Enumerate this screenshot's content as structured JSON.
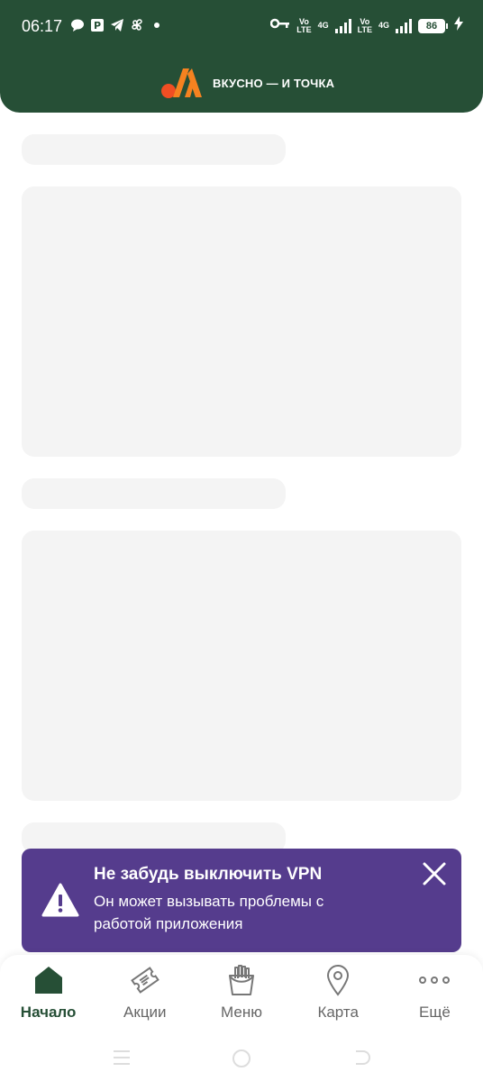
{
  "status_bar": {
    "time": "06:17",
    "volte_1": "Vo\nLTE",
    "net_1": "4G",
    "volte_2": "Vo\nLTE",
    "net_2": "4G",
    "battery": "86",
    "icons_left": [
      "chat-bubble-icon",
      "parking-icon",
      "telegram-icon",
      "fan-icon",
      "dot-icon"
    ],
    "icons_right": [
      "vpn-key-icon",
      "signal-icon",
      "signal-icon",
      "battery-icon",
      "charging-icon"
    ]
  },
  "header": {
    "brand": "ВКУСНО — И ТОЧКА",
    "brand_colors": {
      "dot": "#f04e23",
      "bars": "#f58220"
    },
    "background": "#264f36"
  },
  "toast": {
    "title": "Не забудь выключить VPN",
    "message": "Он может вызывать проблемы с работой приложения",
    "background": "#553c8d",
    "icons": [
      "warning-icon",
      "close-icon"
    ]
  },
  "tabbar": {
    "items": [
      {
        "label": "Начало",
        "icon": "home-icon",
        "active": true
      },
      {
        "label": "Акции",
        "icon": "coupon-icon",
        "active": false
      },
      {
        "label": "Меню",
        "icon": "fries-icon",
        "active": false
      },
      {
        "label": "Карта",
        "icon": "map-pin-icon",
        "active": false
      },
      {
        "label": "Ещё",
        "icon": "more-icon",
        "active": false
      }
    ],
    "active_color": "#264f36"
  },
  "system_nav": {
    "buttons": [
      "menu-icon",
      "home-circle-icon",
      "back-icon"
    ]
  }
}
